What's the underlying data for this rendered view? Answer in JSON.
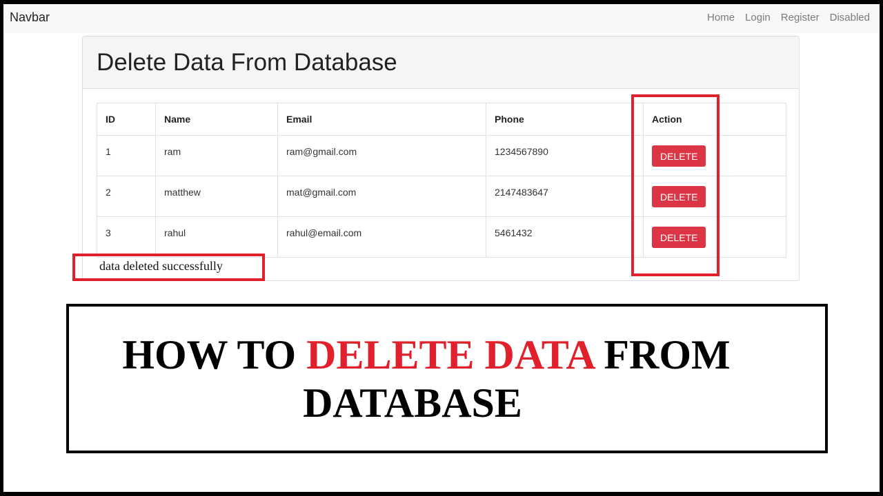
{
  "navbar": {
    "brand": "Navbar",
    "links": [
      "Home",
      "Login",
      "Register",
      "Disabled"
    ]
  },
  "card": {
    "title": "Delete Data From Database"
  },
  "table": {
    "headers": [
      "ID",
      "Name",
      "Email",
      "Phone",
      "Action"
    ],
    "rows": [
      {
        "id": "1",
        "name": "ram",
        "email": "ram@gmail.com",
        "phone": "1234567890",
        "action": "DELETE"
      },
      {
        "id": "2",
        "name": "matthew",
        "email": "mat@gmail.com",
        "phone": "2147483647",
        "action": "DELETE"
      },
      {
        "id": "3",
        "name": "rahul",
        "email": "rahul@email.com",
        "phone": "5461432",
        "action": "DELETE"
      }
    ]
  },
  "message": "data deleted successfully",
  "banner": {
    "line1_start": "HOW TO ",
    "line1_highlight": "DELETE DATA",
    "line1_end": " FROM",
    "line2": "DATABASE"
  },
  "colors": {
    "danger": "#dc3545",
    "highlight_red": "#e0202a",
    "navbar_bg": "#f8f8f8"
  }
}
